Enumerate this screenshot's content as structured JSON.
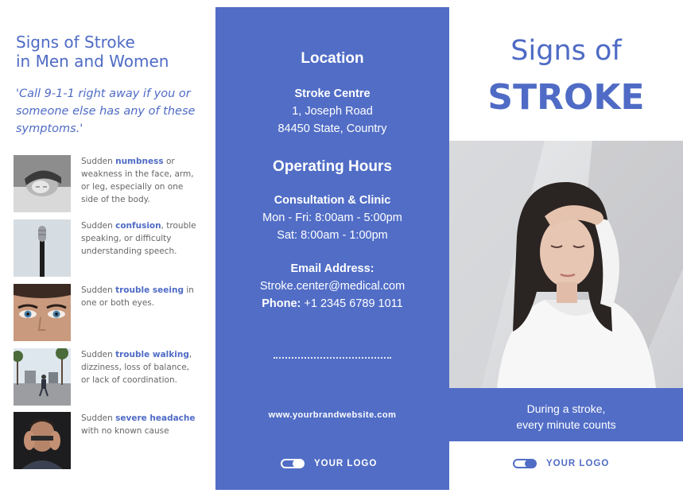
{
  "left": {
    "title_line1": "Signs of Stroke",
    "title_line2": "in Men and Women",
    "quote_line1": "'Call 9-1-1 right away if you or",
    "quote_line2": "someone else has any of these",
    "quote_line3": "symptoms.'",
    "symptoms": [
      {
        "pre": "Sudden ",
        "bold": "numbness",
        "line1_rest": " or",
        "line2": "weakness in the face, arm,",
        "line3": "or leg, especially on one",
        "line4": "side of the body.",
        "image": "sleeping-woman-photo"
      },
      {
        "pre": "Sudden ",
        "bold": "confusion",
        "line1_rest": ", trouble",
        "line2": "speaking, or difficulty",
        "line3": "understanding speech.",
        "line4": "",
        "image": "microphone-photo"
      },
      {
        "pre": "Sudden ",
        "bold": "trouble seeing",
        "line1_rest": " in",
        "line2": "one or both eyes.",
        "line3": "",
        "line4": "",
        "image": "blue-eyes-photo"
      },
      {
        "pre": "Sudden ",
        "bold": "trouble walking",
        "line1_rest": ",",
        "line2": "dizziness, loss of balance,",
        "line3": "or lack of coordination.",
        "line4": "",
        "image": "street-walking-photo"
      },
      {
        "pre": "Sudden ",
        "bold": "severe headache",
        "line1_rest": "",
        "line2": "with no known cause",
        "line3": "",
        "line4": "",
        "image": "man-headache-photo"
      }
    ]
  },
  "middle": {
    "location_heading": "Location",
    "centre_name": "Stroke Centre",
    "address_line1": "1, Joseph Road",
    "address_line2": "84450 State, Country",
    "hours_heading": "Operating Hours",
    "hours_sub": "Consultation & Clinic",
    "hours_line1": "Mon - Fri: 8:00am - 5:00pm",
    "hours_line2": "Sat: 8:00am - 1:00pm",
    "email_heading": "Email Address:",
    "email": "Stroke.center@medical.com",
    "phone_label": "Phone:",
    "phone": " +1 2345 6789 1011",
    "website": "www.yourbrandwebsite.com",
    "logo_text": "YOUR LOGO"
  },
  "right": {
    "title_line1": "Signs of",
    "title_line2": "STROKE",
    "band_line1": "During a stroke,",
    "band_line2": "every minute counts",
    "logo_text": "YOUR LOGO"
  },
  "colors": {
    "accent": "#516dc6",
    "text_accent": "#4f6bc5",
    "body_text": "#666666"
  }
}
